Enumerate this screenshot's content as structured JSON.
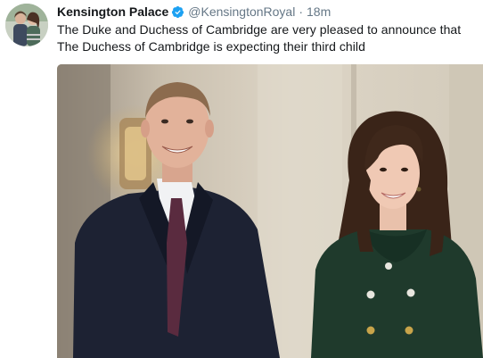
{
  "tweet": {
    "display_name": "Kensington Palace",
    "handle": "@KensingtonRoyal",
    "separator": "·",
    "timestamp": "18m",
    "text": "The Duke and Duchess of Cambridge are very pleased to announce that The Duchess of Cambridge is expecting their third child",
    "verified": true,
    "colors": {
      "verified_badge": "#1da1f2",
      "secondary_text": "#657786",
      "primary_text": "#14171a"
    }
  },
  "icons": {
    "avatar": "avatar-icon",
    "verified": "verified-badge-icon"
  },
  "media": {
    "type": "photo",
    "subject_count": 2
  }
}
